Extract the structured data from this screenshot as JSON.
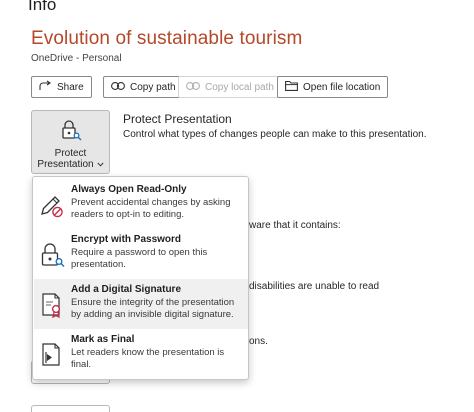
{
  "header": {
    "section": "Info",
    "document_title": "Evolution of sustainable tourism",
    "location": "OneDrive - Personal"
  },
  "toolbar": {
    "share": "Share",
    "copy_path": "Copy path",
    "copy_local_path": "Copy local path",
    "open_file_location": "Open file location"
  },
  "protect": {
    "button_line1": "Protect",
    "button_line2": "Presentation",
    "title": "Protect Presentation",
    "description": "Control what types of changes people can make to this presentation."
  },
  "background_text": {
    "inspect_fragment": "ware that it contains:",
    "accessibility_fragment": "disabilities are unable to read",
    "versions_fragment": "ons."
  },
  "menu": {
    "items": [
      {
        "title": "Always Open Read-Only",
        "description": "Prevent accidental changes by asking readers to opt-in to editing.",
        "icon": "pencil-no-icon"
      },
      {
        "title": "Encrypt with Password",
        "description": "Require a password to open this presentation.",
        "icon": "lock-key-icon"
      },
      {
        "title": "Add a Digital Signature",
        "description": "Ensure the integrity of the presentation by adding an invisible digital signature.",
        "icon": "signature-ribbon-icon"
      },
      {
        "title": "Mark as Final",
        "description": "Let readers know the presentation is final.",
        "icon": "final-document-icon"
      }
    ]
  },
  "colors": {
    "title_accent": "#b5472a",
    "tile_background": "#e6e6e6",
    "hover_background": "#f0f0f0",
    "signature_ribbon": "#c4314b"
  }
}
